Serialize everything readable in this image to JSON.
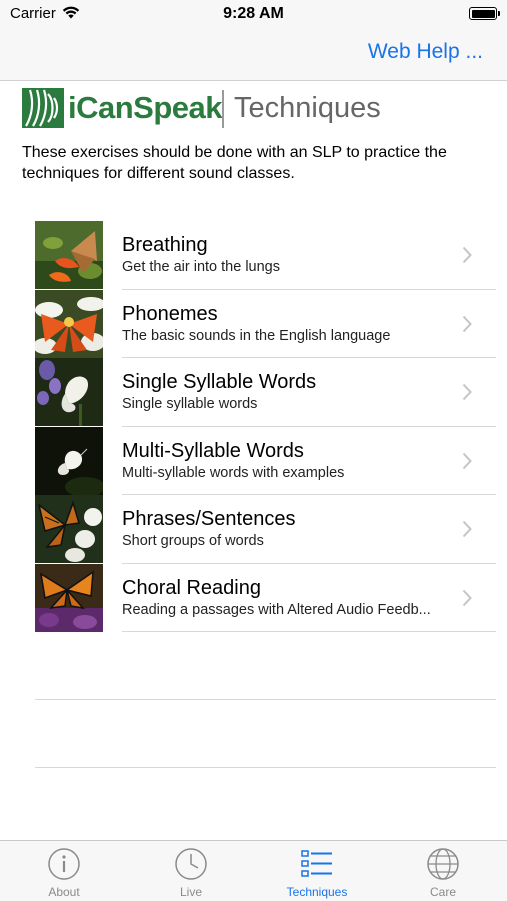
{
  "status_bar": {
    "carrier": "Carrier",
    "time": "9:28 AM"
  },
  "nav": {
    "web_help": "Web Help ..."
  },
  "logo": {
    "name": "iCanSpeak",
    "subtitle": "Techniques"
  },
  "intro_text": "These exercises should be done with an SLP to practice the techniques for different sound classes.",
  "items": [
    {
      "title": "Breathing",
      "subtitle": "Get the air into the lungs"
    },
    {
      "title": "Phonemes",
      "subtitle": "The basic sounds in the English language"
    },
    {
      "title": "Single Syllable Words",
      "subtitle": "Single syllable words"
    },
    {
      "title": "Multi-Syllable Words",
      "subtitle": "Multi-syllable words with examples"
    },
    {
      "title": "Phrases/Sentences",
      "subtitle": "Short groups of words"
    },
    {
      "title": "Choral Reading",
      "subtitle": "Reading a passages with Altered Audio Feedb..."
    }
  ],
  "tabs": [
    {
      "label": "About",
      "icon": "info-icon"
    },
    {
      "label": "Live",
      "icon": "clock-icon"
    },
    {
      "label": "Techniques",
      "icon": "list-icon"
    },
    {
      "label": "Care",
      "icon": "globe-icon"
    }
  ],
  "colors": {
    "accent": "#1a73e8",
    "logo_green": "#2b7a3e",
    "inactive_tab": "#8a8a8a"
  }
}
